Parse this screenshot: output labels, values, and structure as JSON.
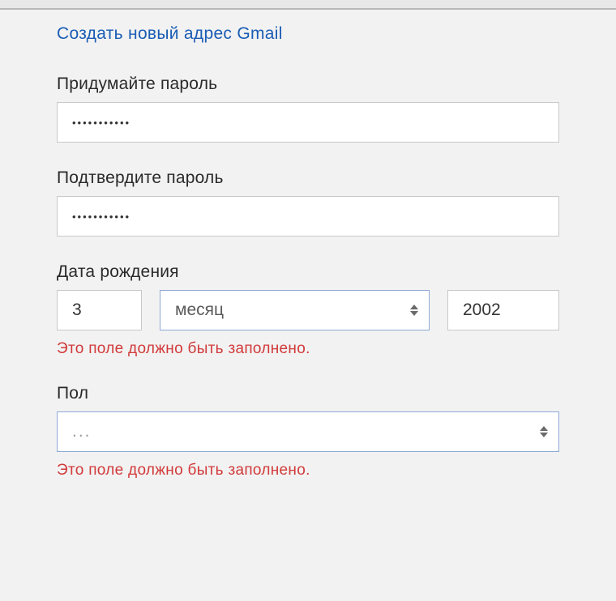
{
  "link": {
    "create_gmail": "Создать новый адрес Gmail"
  },
  "password": {
    "label": "Придумайте пароль",
    "value": "•••••••••••"
  },
  "confirm_password": {
    "label": "Подтвердите пароль",
    "value": "•••••••••••"
  },
  "dob": {
    "label": "Дата рождения",
    "day": "3",
    "month_placeholder": "месяц",
    "year": "2002",
    "error": "Это поле должно быть заполнено."
  },
  "gender": {
    "label": "Пол",
    "value": "...",
    "error": "Это поле должно быть заполнено."
  }
}
